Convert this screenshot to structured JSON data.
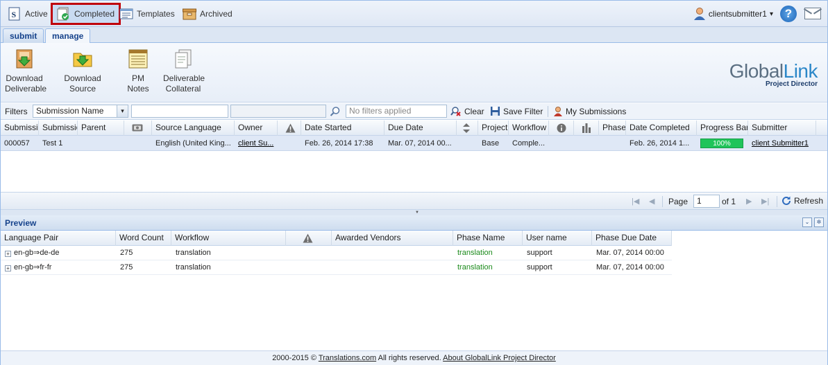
{
  "nav": {
    "items": [
      {
        "label": "Active",
        "icon": "s-document-icon"
      },
      {
        "label": "Completed",
        "icon": "completed-check-icon"
      },
      {
        "label": "Templates",
        "icon": "templates-icon"
      },
      {
        "label": "Archived",
        "icon": "archive-box-icon"
      }
    ],
    "user": "clientsubmitter1",
    "user_caret": "▾",
    "help_label": "?"
  },
  "tabs": [
    {
      "label": "submit"
    },
    {
      "label": "manage"
    }
  ],
  "toolbar": {
    "download_deliverable": "Download Deliverable",
    "download_source": "Download Source",
    "pm_notes": "PM Notes",
    "deliverable_collateral": "Deliverable Collateral"
  },
  "logo": {
    "part1": "Global",
    "part2": "Link",
    "subtitle": "Project Director"
  },
  "filters": {
    "label": "Filters",
    "field": "Submission Name",
    "field_caret": "▾",
    "summary_placeholder": "No filters applied",
    "clear": "Clear",
    "save_filter": "Save Filter",
    "my_submissions": "My Submissions"
  },
  "grid": {
    "columns": [
      "Submission",
      "Submission",
      "Parent",
      "",
      "Source Language",
      "Owner",
      "",
      "Date Started",
      "Due Date",
      "",
      "Project",
      "Workflow S",
      "",
      "",
      "Phase",
      "Date Completed",
      "Progress Bar",
      "Submitter"
    ],
    "rows": [
      {
        "id": "000057",
        "name": "Test 1",
        "parent": "",
        "source_language": "English (United King...",
        "owner": "client Su...",
        "date_started": "Feb. 26, 2014 17:38",
        "due_date": "Mar. 07, 2014 00...",
        "project": "Base",
        "workflow_status": "Comple...",
        "date_completed": "Feb. 26, 2014 1...",
        "progress": "100%",
        "progress_value": 100,
        "submitter": "client Submitter1"
      }
    ]
  },
  "pager": {
    "page_label": "Page",
    "page_value": "1",
    "of_label": "of 1",
    "refresh": "Refresh"
  },
  "preview": {
    "title": "Preview",
    "columns": [
      "Language Pair",
      "Word Count",
      "Workflow",
      "",
      "Awarded Vendors",
      "Phase Name",
      "User name",
      "Phase Due Date"
    ],
    "rows": [
      {
        "pair": "en-gb⇒de-de",
        "words": "275",
        "workflow": "translation",
        "vendors": "",
        "phase": "translation",
        "user": "support",
        "due": "Mar. 07, 2014 00:00"
      },
      {
        "pair": "en-gb⇒fr-fr",
        "words": "275",
        "workflow": "translation",
        "vendors": "",
        "phase": "translation",
        "user": "support",
        "due": "Mar. 07, 2014 00:00"
      }
    ]
  },
  "footer": {
    "prefix": "2000-2015 © ",
    "link1": "Translations.com",
    "middle": " All rights reserved. ",
    "link2": "About GlobalLink Project Director"
  },
  "colors": {
    "accent": "#15428b",
    "highlight_border": "#c0000a",
    "progress": "#1fc45a",
    "phase_green": "#1b8a1b"
  }
}
